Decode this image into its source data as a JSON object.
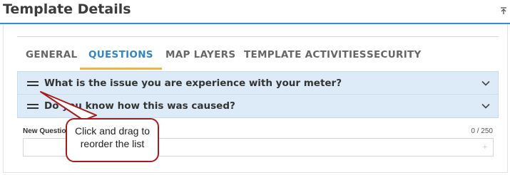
{
  "page": {
    "title": "Template Details"
  },
  "icons": {
    "collapse": "collapse-up-icon",
    "drag": "drag-handle-icon",
    "chevron": "chevron-down-icon",
    "add": "plus-icon"
  },
  "tabs": [
    {
      "label": "GENERAL",
      "active": false
    },
    {
      "label": "QUESTIONS",
      "active": true
    },
    {
      "label": "MAP LAYERS",
      "active": false
    },
    {
      "label": "TEMPLATE ACTIVITIES",
      "active": false
    },
    {
      "label": "SECURITY",
      "active": false
    }
  ],
  "questions": [
    {
      "text": "What is the issue you are experience with your meter?"
    },
    {
      "text": "Do you know how this was caused?"
    }
  ],
  "new_question": {
    "label": "New Question",
    "count": "0 / 250",
    "value": ""
  },
  "callout": {
    "text": "Click and drag to reorder the list"
  },
  "colors": {
    "accent_blue": "#2f86c8",
    "tab_underline": "#f0b24a",
    "row_background": "#dcebf7",
    "callout_border": "#a61c1c"
  }
}
